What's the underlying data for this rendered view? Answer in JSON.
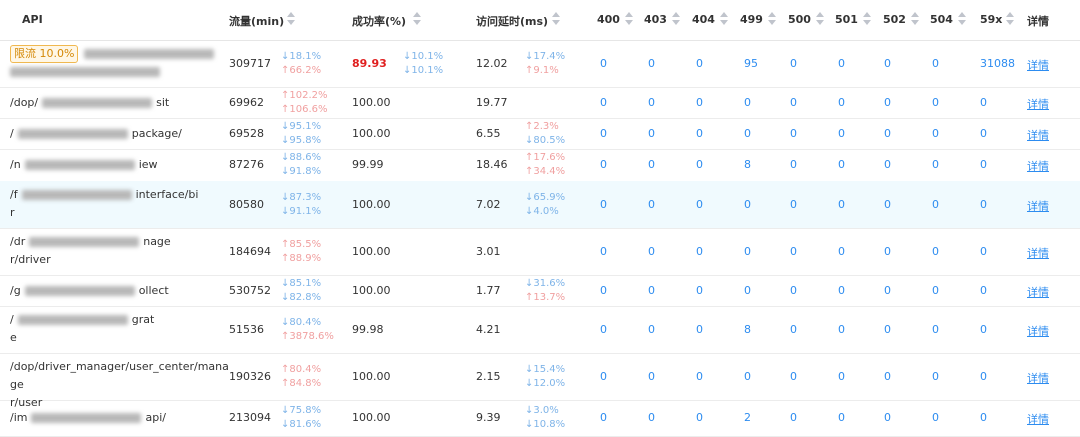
{
  "headers": {
    "api": "API",
    "flow": "流量(min)",
    "success": "成功率(%)",
    "latency": "访问延时(ms)",
    "c400": "400",
    "c403": "403",
    "c404": "404",
    "c499": "499",
    "c500": "500",
    "c501": "501",
    "c502": "502",
    "c504": "504",
    "c59x": "59x",
    "detail": "详情"
  },
  "rows": [
    {
      "api_pre": "",
      "api_mid": "",
      "api_suffix": "",
      "tag": "限流 10.0%",
      "flow": "309717",
      "flow_c1": "↓18.1%",
      "flow_c2": "↑66.2%",
      "success": "89.93",
      "succ_c1": "↓10.1%",
      "succ_c2": "↓10.1%",
      "latency": "12.02",
      "lat_c1": "↓17.4%",
      "lat_c2": "↑9.1%",
      "c400": "0",
      "c403": "0",
      "c404": "0",
      "c499": "95",
      "c500": "0",
      "c501": "0",
      "c502": "0",
      "c504": "0",
      "c59x": "31088",
      "detail": "详情"
    },
    {
      "api_pre": "/dop/",
      "api_suffix": "sit",
      "flow": "69962",
      "flow_c1": "↑102.2%",
      "flow_c2": "↑106.6%",
      "success": "100.00",
      "latency": "19.77",
      "c400": "0",
      "c403": "0",
      "c404": "0",
      "c499": "0",
      "c500": "0",
      "c501": "0",
      "c502": "0",
      "c504": "0",
      "c59x": "0",
      "detail": "详情"
    },
    {
      "api_pre": "/",
      "api_suffix": "package/",
      "flow": "69528",
      "flow_c1": "↓95.1%",
      "flow_c2": "↓95.8%",
      "success": "100.00",
      "latency": "6.55",
      "lat_c1": "↑2.3%",
      "lat_c2": "↓80.5%",
      "c400": "0",
      "c403": "0",
      "c404": "0",
      "c499": "0",
      "c500": "0",
      "c501": "0",
      "c502": "0",
      "c504": "0",
      "c59x": "0",
      "detail": "详情"
    },
    {
      "api_pre": "/n",
      "api_suffix": "iew",
      "flow": "87276",
      "flow_c1": "↓88.6%",
      "flow_c2": "↓91.8%",
      "success": "99.99",
      "latency": "18.46",
      "lat_c1": "↑17.6%",
      "lat_c2": "↑34.4%",
      "c400": "0",
      "c403": "0",
      "c404": "0",
      "c499": "8",
      "c500": "0",
      "c501": "0",
      "c502": "0",
      "c504": "0",
      "c59x": "0",
      "detail": "详情"
    },
    {
      "api_pre": "/f",
      "api_suffix": "interface/bi",
      "api_line2": "r",
      "flow": "80580",
      "flow_c1": "↓87.3%",
      "flow_c2": "↓91.1%",
      "success": "100.00",
      "latency": "7.02",
      "lat_c1": "↓65.9%",
      "lat_c2": "↓4.0%",
      "c400": "0",
      "c403": "0",
      "c404": "0",
      "c499": "0",
      "c500": "0",
      "c501": "0",
      "c502": "0",
      "c504": "0",
      "c59x": "0",
      "detail": "详情"
    },
    {
      "api_pre": "/dr",
      "api_suffix": "nage",
      "api_line2": "r/driver",
      "flow": "184694",
      "flow_c1": "↑85.5%",
      "flow_c2": "↑88.9%",
      "success": "100.00",
      "latency": "3.01",
      "c400": "0",
      "c403": "0",
      "c404": "0",
      "c499": "0",
      "c500": "0",
      "c501": "0",
      "c502": "0",
      "c504": "0",
      "c59x": "0",
      "detail": "详情"
    },
    {
      "api_pre": "/g",
      "api_suffix": "ollect",
      "flow": "530752",
      "flow_c1": "↓85.1%",
      "flow_c2": "↓82.8%",
      "success": "100.00",
      "latency": "1.77",
      "lat_c1": "↓31.6%",
      "lat_c2": "↑13.7%",
      "c400": "0",
      "c403": "0",
      "c404": "0",
      "c499": "0",
      "c500": "0",
      "c501": "0",
      "c502": "0",
      "c504": "0",
      "c59x": "0",
      "detail": "详情"
    },
    {
      "api_pre": "/",
      "api_suffix": "grat",
      "api_line2": "e",
      "flow": "51536",
      "flow_c1": "↓80.4%",
      "flow_c2": "↑3878.6%",
      "success": "99.98",
      "latency": "4.21",
      "c400": "0",
      "c403": "0",
      "c404": "0",
      "c499": "8",
      "c500": "0",
      "c501": "0",
      "c502": "0",
      "c504": "0",
      "c59x": "0",
      "detail": "详情"
    },
    {
      "api_pre": "/dop/driver_manager/user_center/manage",
      "api_line2": "r/user",
      "flow": "190326",
      "flow_c1": "↑80.4%",
      "flow_c2": "↑84.8%",
      "success": "100.00",
      "latency": "2.15",
      "lat_c1": "↓15.4%",
      "lat_c2": "↓12.0%",
      "c400": "0",
      "c403": "0",
      "c404": "0",
      "c499": "0",
      "c500": "0",
      "c501": "0",
      "c502": "0",
      "c504": "0",
      "c59x": "0",
      "detail": "详情"
    },
    {
      "api_pre": "/im",
      "api_suffix": "api/",
      "flow": "213094",
      "flow_c1": "↓75.8%",
      "flow_c2": "↓81.6%",
      "success": "100.00",
      "latency": "9.39",
      "lat_c1": "↓3.0%",
      "lat_c2": "↓10.8%",
      "c400": "0",
      "c403": "0",
      "c404": "0",
      "c499": "2",
      "c500": "0",
      "c501": "0",
      "c502": "0",
      "c504": "0",
      "c59x": "0",
      "detail": "详情"
    }
  ]
}
